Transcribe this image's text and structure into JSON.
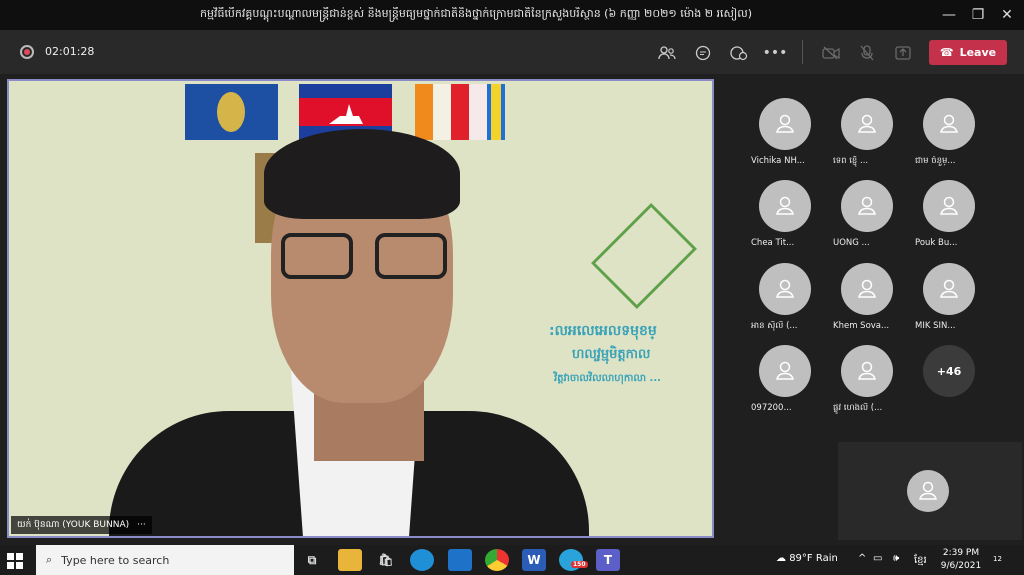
{
  "window": {
    "title": "កម្មវិធីបើកវគ្គបណ្តុះបណ្តាលមន្ត្រីជាន់ខ្ពស់ និងមន្ត្រីមធ្យមថ្នាក់ជាតិនិងថ្នាក់ក្រោមជាតិនៃក្រសួងបរិស្ថាន (៦ កញ្ញា ២០២១ ម៉ោង ២ រសៀល)",
    "minimize": "—",
    "maximize": "❐",
    "close": "✕"
  },
  "meeting": {
    "timer": "02:01:28",
    "leave_label": "Leave",
    "presenter_name": "យក់ ប៊ុនណា (YOUK BUNNA)",
    "presenter_more": "···",
    "overflow_count": "+46"
  },
  "background_text": {
    "line1": ":លអលេអេលទមុខម្",
    "line2": "ហលវ្ចម្មុមិត្តកាល",
    "line3": "វិត្តវាចាលវិលលាហុកាលា ..."
  },
  "participants": [
    {
      "name": "Vichika NH..."
    },
    {
      "name": "ទេព ខ្ញ៉ើ ..."
    },
    {
      "name": "ជាម ចំនួម្..."
    },
    {
      "name": "Chea Tit..."
    },
    {
      "name": "UONG ..."
    },
    {
      "name": "Pouk Bu..."
    },
    {
      "name": "អាន ស៊ីលី (..."
    },
    {
      "name": "Khem Sova..."
    },
    {
      "name": "MIK SIN..."
    },
    {
      "name": "097200..."
    },
    {
      "name": "ផ្លូវ ហេងលី (..."
    }
  ],
  "taskbar": {
    "search_placeholder": "Type here to search",
    "weather": "89°F  Rain",
    "lang": "ខ្មែរ",
    "time": "2:39 PM",
    "date": "9/6/2021",
    "notification_count": "12",
    "telegram_badge": "150"
  },
  "colors": {
    "leave": "#c4314b",
    "stage_border": "#8b8cc7",
    "teams_accent": "#5b5fc7"
  }
}
